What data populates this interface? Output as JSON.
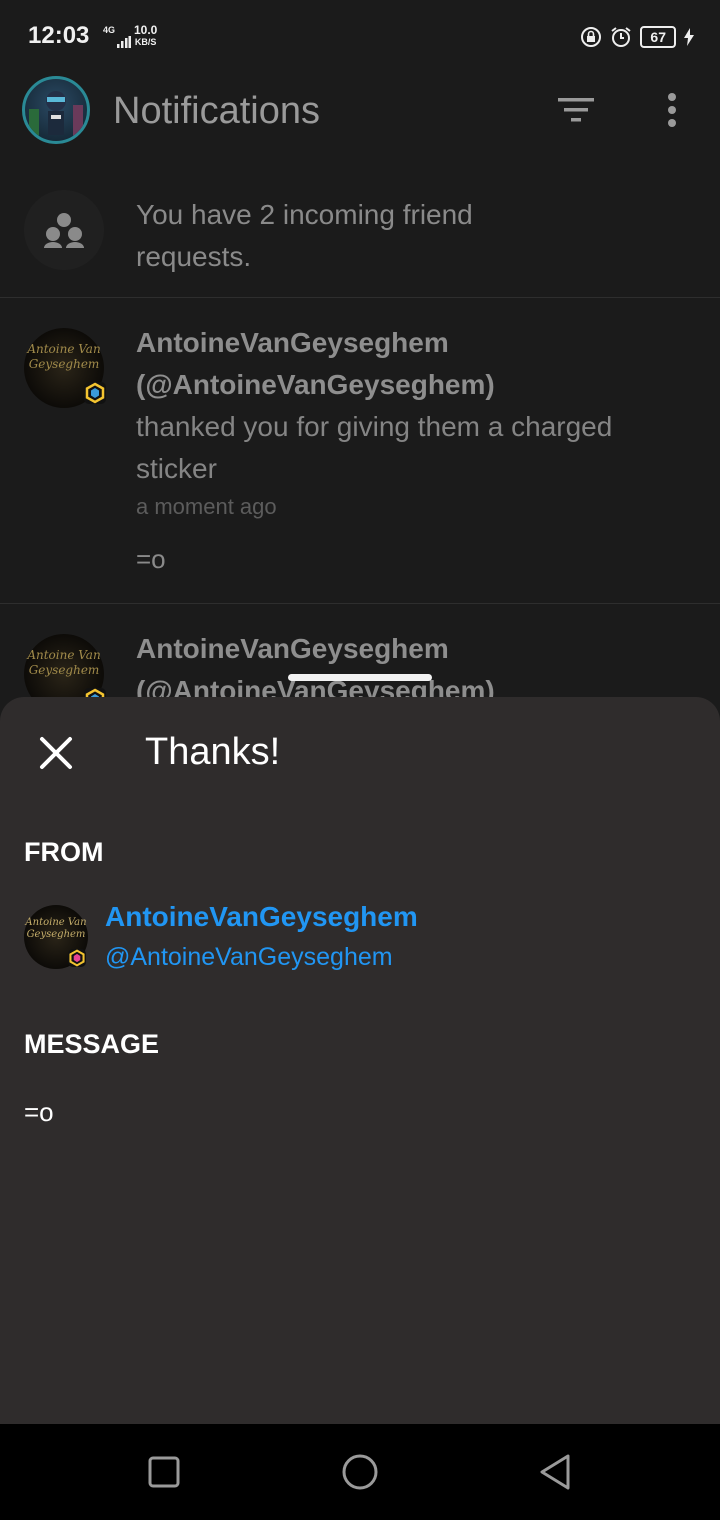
{
  "status_bar": {
    "time": "12:03",
    "network": "4G",
    "speed_value": "10.0",
    "speed_unit": "KB/S",
    "battery": "67"
  },
  "header": {
    "title": "Notifications"
  },
  "notifications": [
    {
      "type": "friend-requests",
      "text": "You have 2 incoming friend requests."
    },
    {
      "type": "thanks",
      "avatar_text": "Antoine Van Geyseghem",
      "name": "AntoineVanGeyseghem",
      "handle": "(@AntoineVanGeyseghem)",
      "body": "thanked you for giving them a charged sticker",
      "time": "a moment ago",
      "message": "=o"
    },
    {
      "type": "thanks",
      "avatar_text": "Antoine Van Geyseghem",
      "name": "AntoineVanGeyseghem",
      "handle": "(@AntoineVanGeyseghem)"
    }
  ],
  "sheet": {
    "title": "Thanks!",
    "from_label": "FROM",
    "from_avatar_text": "Antoine Van Geyseghem",
    "from_name": "AntoineVanGeyseghem",
    "from_handle": "@AntoineVanGeyseghem",
    "message_label": "MESSAGE",
    "message": "=o"
  },
  "colors": {
    "accent_blue": "#2196f3",
    "sheet_bg": "#2f2c2c",
    "page_bg": "#1b1b1b"
  },
  "icons": {
    "header": [
      "filter-icon",
      "more-vertical-icon"
    ],
    "sheet": [
      "close-icon"
    ],
    "nav": [
      "recent-apps-icon",
      "home-icon",
      "back-icon"
    ]
  }
}
